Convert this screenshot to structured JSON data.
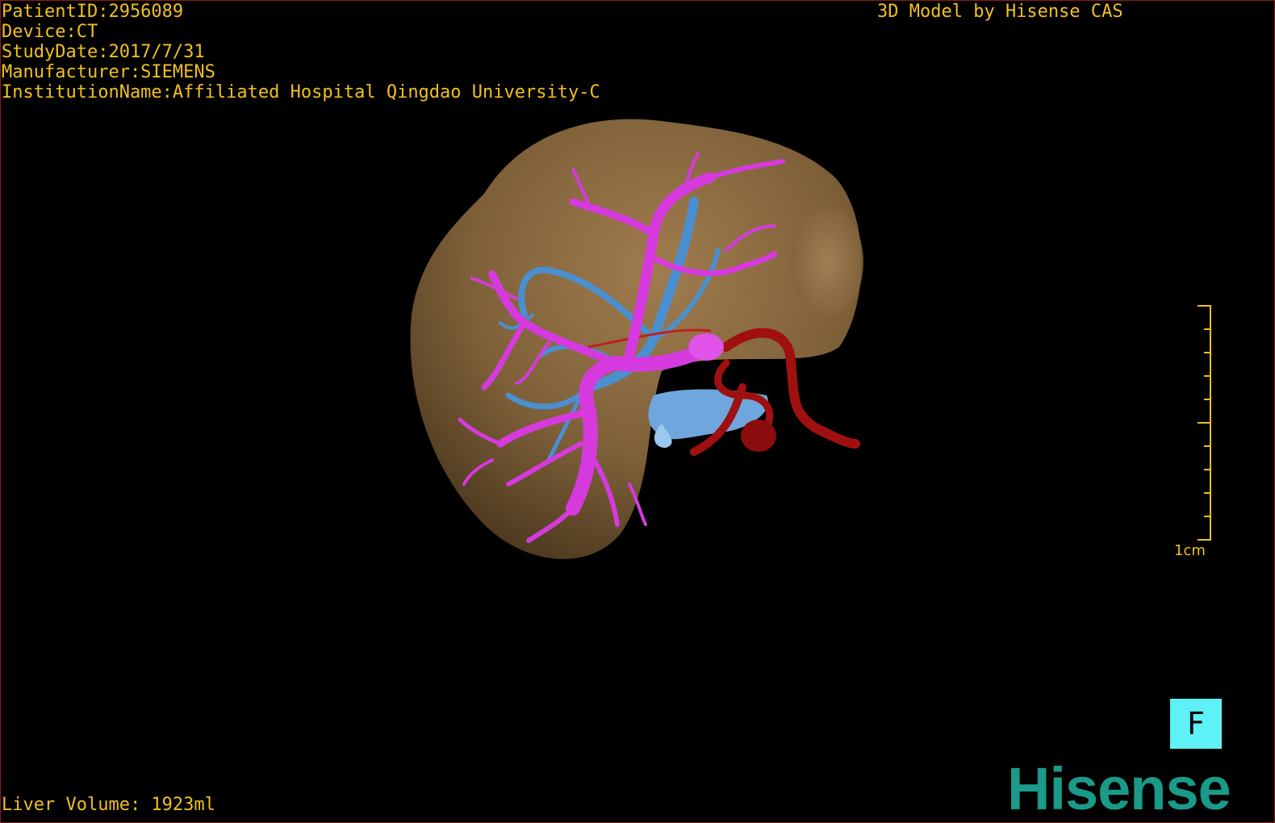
{
  "header": {
    "patient_id": "PatientID:2956089",
    "device": "Device:CT",
    "study_date": "StudyDate:2017/7/31",
    "manufacturer": "Manufacturer:SIEMENS",
    "institution": "InstitutionName:Affiliated Hospital Qingdao University-C",
    "model_credit": "3D Model by Hisense CAS"
  },
  "footer": {
    "liver_volume": "Liver Volume: 1923ml"
  },
  "scale": {
    "label": "1cm"
  },
  "orientation": {
    "label": "F"
  },
  "brand": {
    "logo_text": "Hisense"
  },
  "colors": {
    "overlay_text": "#f0c020",
    "liver": "#8a6a40",
    "portal_vein": "#d63adf",
    "hepatic_vein": "#4a8fd0",
    "artery": "#a01010",
    "orientation_bg": "#5ef1f7",
    "logo": "#1a9a88"
  }
}
